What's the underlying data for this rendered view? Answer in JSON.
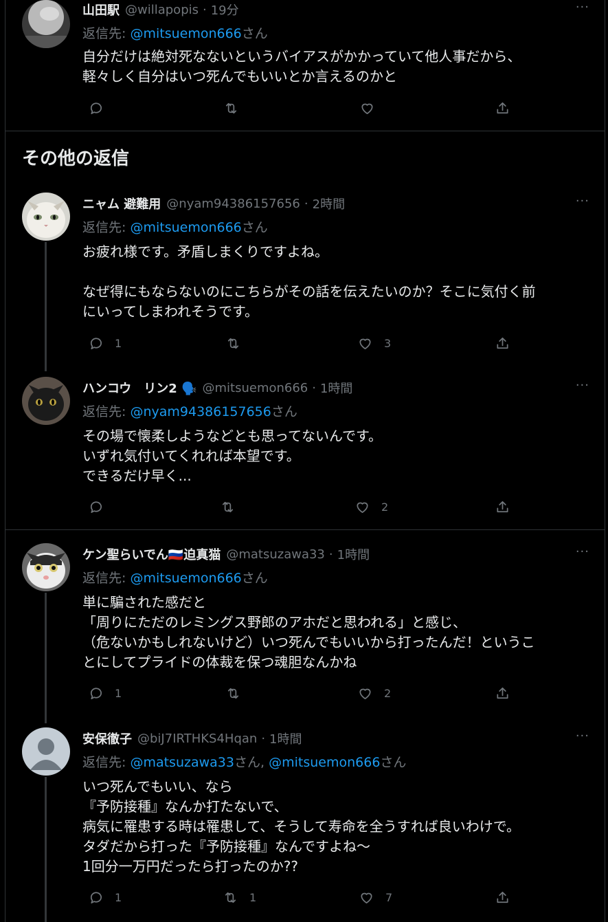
{
  "section_title": "その他の返信",
  "reply_to_label": "返信先:",
  "san": "さん",
  "more": "···",
  "tweets": [
    {
      "name": "山田駅",
      "handle": "@willapopis",
      "time": "19分",
      "reply_to": [
        "@mitsuemon666"
      ],
      "text": "自分だけは絶対死なないというバイアスがかかっていて他人事だから、\n軽々しく自分はいつ死んでもいいとか言えるのかと",
      "replies": "",
      "retweets": "",
      "likes": ""
    },
    {
      "name": "ニャム 避難用",
      "handle": "@nyam94386157656",
      "time": "2時間",
      "reply_to": [
        "@mitsuemon666"
      ],
      "text": "お疲れ様です。矛盾しまくりですよね。\n\nなぜ得にもならないのにこちらがその話を伝えたいのか？そこに気付く前\nにいってしまわれそうです。",
      "replies": "1",
      "retweets": "",
      "likes": "3"
    },
    {
      "name": "ハンコウ　リン2 🗣️",
      "handle": "@mitsuemon666",
      "time": "1時間",
      "reply_to": [
        "@nyam94386157656"
      ],
      "text": "その場で懐柔しようなどとも思ってないんです。\nいずれ気付いてくれれば本望です。\nできるだけ早く...",
      "replies": "",
      "retweets": "",
      "likes": "2"
    },
    {
      "name": "ケン聖らいでん🇷🇺迫真猫",
      "handle": "@matsuzawa33",
      "time": "1時間",
      "reply_to": [
        "@mitsuemon666"
      ],
      "text": "単に騙された感だと\n「周りにただのレミングス野郎のアホだと思われる」と感じ、\n（危ないかもしれないけど）いつ死んでもいいから打ったんだ！というこ\nとにしてプライドの体裁を保つ魂胆なんかね",
      "replies": "1",
      "retweets": "",
      "likes": "2"
    },
    {
      "name": "安保徹子",
      "handle": "@biJ7IRTHKS4Hqan",
      "time": "1時間",
      "reply_to": [
        "@matsuzawa33",
        "@mitsuemon666"
      ],
      "text": "いつ死んでもいい、なら\n『予防接種』なんか打たないで、\n病気に罹患する時は罹患して、そうして寿命を全うすれば良いわけで。\nタダだから打った『予防接種』なんですよね～\n1回分一万円だったら打ったのか??",
      "replies": "1",
      "retweets": "1",
      "likes": "7"
    }
  ]
}
